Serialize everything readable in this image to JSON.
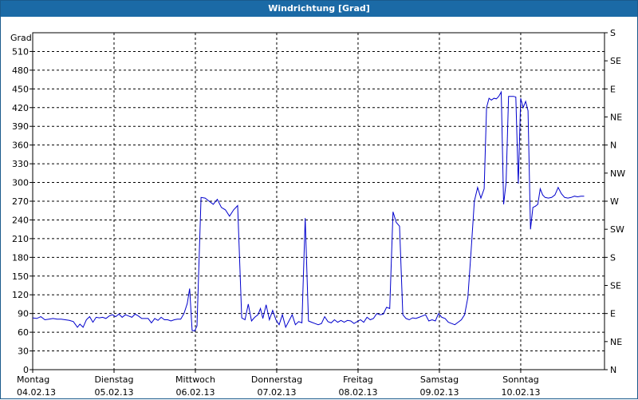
{
  "window": {
    "title": "Windrichtung [Grad]"
  },
  "chart_data": {
    "type": "line",
    "title": "Windrichtung [Grad]",
    "ylabel": "Grad",
    "ylim": [
      0,
      540
    ],
    "yticks": [
      0,
      30,
      60,
      90,
      120,
      150,
      180,
      210,
      240,
      270,
      300,
      330,
      360,
      390,
      420,
      450,
      480,
      510
    ],
    "xlim": [
      0,
      7.03
    ],
    "xticks": [
      {
        "x": 0,
        "day": "Montag",
        "date": "04.02.13"
      },
      {
        "x": 1,
        "day": "Dienstag",
        "date": "05.02.13"
      },
      {
        "x": 2,
        "day": "Mittwoch",
        "date": "06.02.13"
      },
      {
        "x": 3,
        "day": "Donnerstag",
        "date": "07.02.13"
      },
      {
        "x": 4,
        "day": "Freitag",
        "date": "08.02.13"
      },
      {
        "x": 5,
        "day": "Samstag",
        "date": "09.02.13"
      },
      {
        "x": 6,
        "day": "Sonntag",
        "date": "10.02.13"
      }
    ],
    "right_axis": [
      {
        "value": 0,
        "label": "N"
      },
      {
        "value": 45,
        "label": "NE"
      },
      {
        "value": 90,
        "label": "E"
      },
      {
        "value": 135,
        "label": "SE"
      },
      {
        "value": 180,
        "label": "S"
      },
      {
        "value": 225,
        "label": "SW"
      },
      {
        "value": 270,
        "label": "W"
      },
      {
        "value": 315,
        "label": "NW"
      },
      {
        "value": 360,
        "label": "N"
      },
      {
        "value": 405,
        "label": "NE"
      },
      {
        "value": 450,
        "label": "E"
      },
      {
        "value": 495,
        "label": "SE"
      },
      {
        "value": 540,
        "label": "S"
      }
    ],
    "grid": true,
    "line_color": "#0000cc",
    "series": [
      {
        "points": [
          [
            0.0,
            83
          ],
          [
            0.05,
            82
          ],
          [
            0.1,
            85
          ],
          [
            0.15,
            80
          ],
          [
            0.2,
            81
          ],
          [
            0.25,
            82
          ],
          [
            0.3,
            81
          ],
          [
            0.35,
            81
          ],
          [
            0.4,
            80
          ],
          [
            0.45,
            79
          ],
          [
            0.5,
            77
          ],
          [
            0.55,
            68
          ],
          [
            0.58,
            73
          ],
          [
            0.62,
            68
          ],
          [
            0.66,
            80
          ],
          [
            0.7,
            85
          ],
          [
            0.74,
            76
          ],
          [
            0.78,
            84
          ],
          [
            0.82,
            83
          ],
          [
            0.86,
            84
          ],
          [
            0.9,
            82
          ],
          [
            0.94,
            86
          ],
          [
            0.98,
            88
          ],
          [
            1.02,
            85
          ],
          [
            1.06,
            89
          ],
          [
            1.1,
            84
          ],
          [
            1.14,
            88
          ],
          [
            1.18,
            86
          ],
          [
            1.22,
            84
          ],
          [
            1.26,
            89
          ],
          [
            1.3,
            86
          ],
          [
            1.34,
            82
          ],
          [
            1.38,
            82
          ],
          [
            1.42,
            82
          ],
          [
            1.46,
            75
          ],
          [
            1.5,
            82
          ],
          [
            1.54,
            79
          ],
          [
            1.58,
            84
          ],
          [
            1.62,
            80
          ],
          [
            1.66,
            80
          ],
          [
            1.7,
            78
          ],
          [
            1.74,
            80
          ],
          [
            1.78,
            81
          ],
          [
            1.82,
            81
          ],
          [
            1.86,
            90
          ],
          [
            1.9,
            106
          ],
          [
            1.93,
            130
          ],
          [
            1.96,
            63
          ],
          [
            1.99,
            62
          ],
          [
            2.02,
            70
          ],
          [
            2.07,
            276
          ],
          [
            2.12,
            275
          ],
          [
            2.17,
            270
          ],
          [
            2.22,
            265
          ],
          [
            2.27,
            273
          ],
          [
            2.32,
            260
          ],
          [
            2.37,
            256
          ],
          [
            2.42,
            246
          ],
          [
            2.47,
            256
          ],
          [
            2.52,
            263
          ],
          [
            2.57,
            83
          ],
          [
            2.61,
            80
          ],
          [
            2.65,
            105
          ],
          [
            2.69,
            78
          ],
          [
            2.73,
            84
          ],
          [
            2.77,
            88
          ],
          [
            2.8,
            98
          ],
          [
            2.83,
            82
          ],
          [
            2.87,
            104
          ],
          [
            2.91,
            80
          ],
          [
            2.95,
            95
          ],
          [
            2.99,
            80
          ],
          [
            3.03,
            72
          ],
          [
            3.07,
            88
          ],
          [
            3.11,
            68
          ],
          [
            3.15,
            78
          ],
          [
            3.19,
            88
          ],
          [
            3.23,
            72
          ],
          [
            3.27,
            77
          ],
          [
            3.31,
            75
          ],
          [
            3.35,
            243
          ],
          [
            3.39,
            78
          ],
          [
            3.43,
            76
          ],
          [
            3.47,
            74
          ],
          [
            3.51,
            72
          ],
          [
            3.55,
            74
          ],
          [
            3.59,
            85
          ],
          [
            3.63,
            77
          ],
          [
            3.67,
            75
          ],
          [
            3.71,
            80
          ],
          [
            3.75,
            76
          ],
          [
            3.79,
            79
          ],
          [
            3.83,
            76
          ],
          [
            3.87,
            79
          ],
          [
            3.91,
            78
          ],
          [
            3.95,
            74
          ],
          [
            3.99,
            77
          ],
          [
            4.03,
            80
          ],
          [
            4.07,
            76
          ],
          [
            4.11,
            84
          ],
          [
            4.15,
            80
          ],
          [
            4.19,
            82
          ],
          [
            4.23,
            90
          ],
          [
            4.27,
            88
          ],
          [
            4.31,
            89
          ],
          [
            4.35,
            100
          ],
          [
            4.39,
            98
          ],
          [
            4.43,
            253
          ],
          [
            4.47,
            236
          ],
          [
            4.51,
            230
          ],
          [
            4.55,
            88
          ],
          [
            4.59,
            82
          ],
          [
            4.63,
            80
          ],
          [
            4.67,
            83
          ],
          [
            4.71,
            82
          ],
          [
            4.75,
            84
          ],
          [
            4.79,
            86
          ],
          [
            4.83,
            88
          ],
          [
            4.87,
            78
          ],
          [
            4.91,
            80
          ],
          [
            4.95,
            78
          ],
          [
            4.99,
            90
          ],
          [
            5.03,
            84
          ],
          [
            5.07,
            82
          ],
          [
            5.11,
            76
          ],
          [
            5.15,
            74
          ],
          [
            5.19,
            72
          ],
          [
            5.23,
            76
          ],
          [
            5.27,
            80
          ],
          [
            5.31,
            88
          ],
          [
            5.35,
            116
          ],
          [
            5.39,
            190
          ],
          [
            5.43,
            270
          ],
          [
            5.47,
            292
          ],
          [
            5.51,
            275
          ],
          [
            5.55,
            290
          ],
          [
            5.58,
            420
          ],
          [
            5.61,
            435
          ],
          [
            5.64,
            432
          ],
          [
            5.67,
            435
          ],
          [
            5.7,
            434
          ],
          [
            5.73,
            438
          ],
          [
            5.76,
            445
          ],
          [
            5.79,
            265
          ],
          [
            5.82,
            300
          ],
          [
            5.85,
            438
          ],
          [
            5.88,
            438
          ],
          [
            5.91,
            438
          ],
          [
            5.94,
            437
          ],
          [
            5.97,
            298
          ],
          [
            6.0,
            435
          ],
          [
            6.03,
            420
          ],
          [
            6.06,
            430
          ],
          [
            6.09,
            415
          ],
          [
            6.12,
            225
          ],
          [
            6.15,
            260
          ],
          [
            6.18,
            262
          ],
          [
            6.21,
            265
          ],
          [
            6.24,
            290
          ],
          [
            6.27,
            280
          ],
          [
            6.3,
            276
          ],
          [
            6.34,
            275
          ],
          [
            6.38,
            276
          ],
          [
            6.42,
            280
          ],
          [
            6.46,
            292
          ],
          [
            6.5,
            282
          ],
          [
            6.54,
            276
          ],
          [
            6.58,
            275
          ],
          [
            6.62,
            276
          ],
          [
            6.66,
            278
          ],
          [
            6.7,
            277
          ],
          [
            6.74,
            278
          ],
          [
            6.78,
            278
          ]
        ]
      }
    ]
  }
}
